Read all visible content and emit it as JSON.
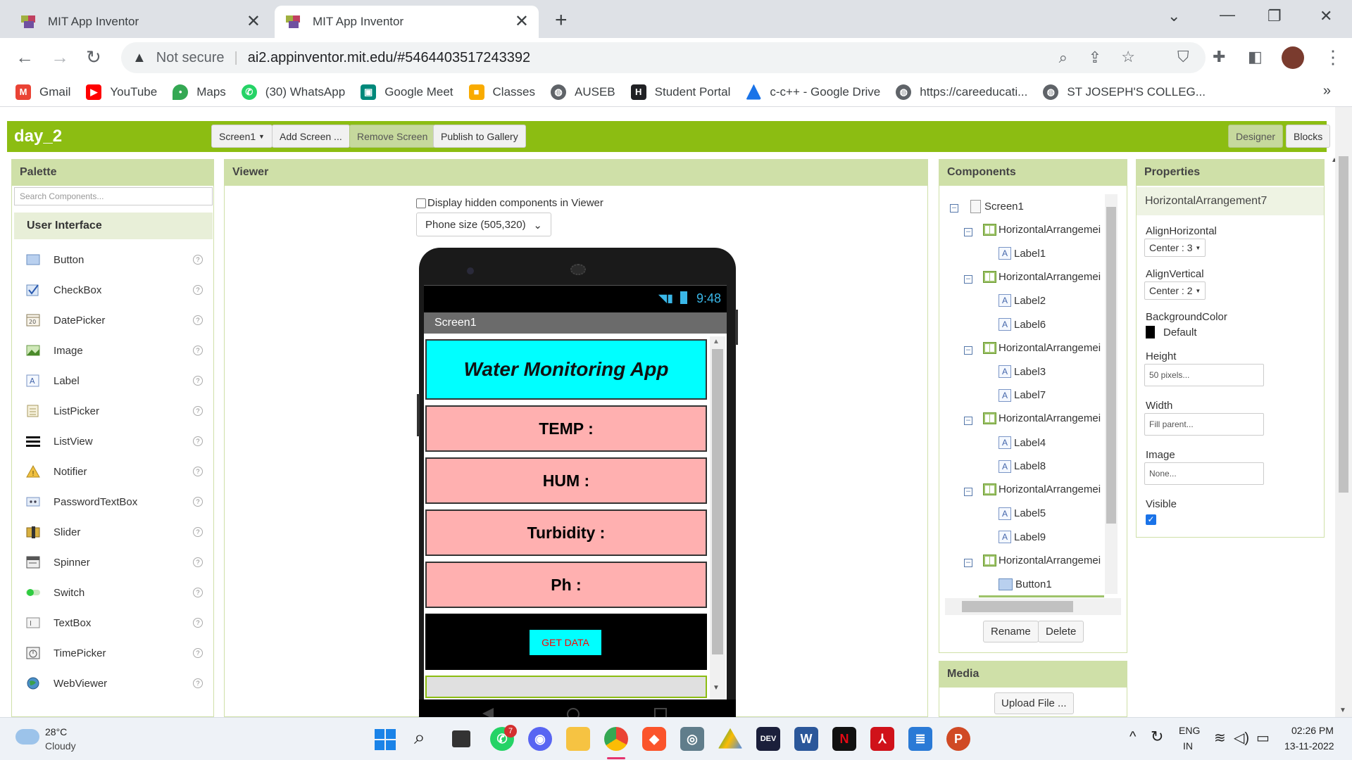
{
  "browser": {
    "tabs": [
      {
        "title": "MIT App Inventor",
        "active": false
      },
      {
        "title": "MIT App Inventor",
        "active": true
      }
    ],
    "security_label": "Not secure",
    "url": "ai2.appinventor.mit.edu/#5464403517243392",
    "bookmarks": [
      {
        "label": "Gmail",
        "icon": "gmail-icon",
        "color": "#ea4335"
      },
      {
        "label": "YouTube",
        "icon": "youtube-icon",
        "color": "#ff0000"
      },
      {
        "label": "Maps",
        "icon": "maps-icon",
        "color": "#34a853"
      },
      {
        "label": "(30) WhatsApp",
        "icon": "whatsapp-icon",
        "color": "#25d366"
      },
      {
        "label": "Google Meet",
        "icon": "meet-icon",
        "color": "#00897b"
      },
      {
        "label": "Classes",
        "icon": "classroom-icon",
        "color": "#f9ab00"
      },
      {
        "label": "AUSEB",
        "icon": "globe-icon",
        "color": "#5f6368"
      },
      {
        "label": "Student Portal",
        "icon": "portal-icon",
        "color": "#202124"
      },
      {
        "label": "c-c++ - Google Drive",
        "icon": "drive-icon",
        "color": "#1a73e8"
      },
      {
        "label": "https://careeducati...",
        "icon": "globe-icon",
        "color": "#5f6368"
      },
      {
        "label": "ST JOSEPH'S COLLEG...",
        "icon": "globe-icon",
        "color": "#5f6368"
      }
    ],
    "more_bookmarks": "»"
  },
  "app": {
    "project_name": "day_2",
    "toolbar": {
      "screen_select": "Screen1",
      "add_screen": "Add Screen ...",
      "remove_screen": "Remove Screen",
      "publish": "Publish to Gallery",
      "designer": "Designer",
      "blocks": "Blocks"
    },
    "palette": {
      "title": "Palette",
      "search_placeholder": "Search Components...",
      "category": "User Interface",
      "items": [
        "Button",
        "CheckBox",
        "DatePicker",
        "Image",
        "Label",
        "ListPicker",
        "ListView",
        "Notifier",
        "PasswordTextBox",
        "Slider",
        "Spinner",
        "Switch",
        "TextBox",
        "TimePicker",
        "WebViewer"
      ],
      "help_glyph": "?"
    },
    "viewer": {
      "title": "Viewer",
      "hidden_checkbox_label": "Display hidden components in Viewer",
      "phone_size": "Phone size (505,320)",
      "phone": {
        "time": "9:48",
        "screen_title": "Screen1",
        "app_title": "Water Monitoring App",
        "labels": [
          "TEMP :",
          "HUM :",
          "Turbidity :",
          "Ph :"
        ],
        "button": "GET DATA",
        "colors": {
          "title_bg": "#00ffff",
          "label_bg": "#ffb0b0",
          "button_bg": "#00ffff",
          "button_text": "#ff0000"
        }
      }
    },
    "components": {
      "title": "Components",
      "tree": [
        {
          "name": "Screen1",
          "depth": 0,
          "type": "screen",
          "toggle": true
        },
        {
          "name": "HorizontalArrangemei",
          "depth": 1,
          "type": "hz",
          "toggle": true
        },
        {
          "name": "Label1",
          "depth": 2,
          "type": "label",
          "toggle": false
        },
        {
          "name": "HorizontalArrangemei",
          "depth": 1,
          "type": "hz",
          "toggle": true
        },
        {
          "name": "Label2",
          "depth": 2,
          "type": "label",
          "toggle": false
        },
        {
          "name": "Label6",
          "depth": 2,
          "type": "label",
          "toggle": false
        },
        {
          "name": "HorizontalArrangemei",
          "depth": 1,
          "type": "hz",
          "toggle": true
        },
        {
          "name": "Label3",
          "depth": 2,
          "type": "label",
          "toggle": false
        },
        {
          "name": "Label7",
          "depth": 2,
          "type": "label",
          "toggle": false
        },
        {
          "name": "HorizontalArrangemei",
          "depth": 1,
          "type": "hz",
          "toggle": true
        },
        {
          "name": "Label4",
          "depth": 2,
          "type": "label",
          "toggle": false
        },
        {
          "name": "Label8",
          "depth": 2,
          "type": "label",
          "toggle": false
        },
        {
          "name": "HorizontalArrangemei",
          "depth": 1,
          "type": "hz",
          "toggle": true
        },
        {
          "name": "Label5",
          "depth": 2,
          "type": "label",
          "toggle": false
        },
        {
          "name": "Label9",
          "depth": 2,
          "type": "label",
          "toggle": false
        },
        {
          "name": "HorizontalArrangemei",
          "depth": 1,
          "type": "hz",
          "toggle": true
        },
        {
          "name": "Button1",
          "depth": 2,
          "type": "button",
          "toggle": false
        }
      ],
      "rename": "Rename",
      "delete": "Delete"
    },
    "media": {
      "title": "Media",
      "upload": "Upload File ..."
    },
    "properties": {
      "title": "Properties",
      "component": "HorizontalArrangement7",
      "align_horizontal": {
        "label": "AlignHorizontal",
        "value": "Center : 3"
      },
      "align_vertical": {
        "label": "AlignVertical",
        "value": "Center : 2"
      },
      "background_color": {
        "label": "BackgroundColor",
        "value": "Default"
      },
      "height": {
        "label": "Height",
        "value": "50 pixels..."
      },
      "width": {
        "label": "Width",
        "value": "Fill parent..."
      },
      "image": {
        "label": "Image",
        "value": "None..."
      },
      "visible": {
        "label": "Visible",
        "checked": true
      }
    }
  },
  "taskbar": {
    "weather_temp": "28°C",
    "weather_desc": "Cloudy",
    "whatsapp_badge": "7",
    "lang_top": "ENG",
    "lang_bottom": "IN",
    "time": "02:26 PM",
    "date": "13-11-2022"
  }
}
